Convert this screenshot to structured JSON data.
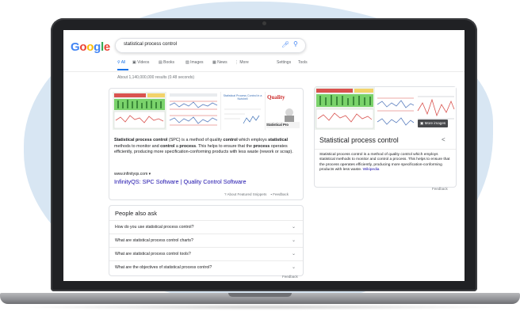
{
  "colors": {
    "blob": "#d8e6f3",
    "laptop_frame": "#202124",
    "google_blue": "#4285f4",
    "google_red": "#ea4335",
    "google_yellow": "#fbbc05",
    "google_green": "#34a853",
    "link": "#1a0dab",
    "active_tab": "#1a73e8",
    "quality_red": "#cc2a2a",
    "chart_green": "#7ad36b"
  },
  "google": {
    "logo": {
      "g": "G",
      "o1": "o",
      "o2": "o",
      "g2": "g",
      "l": "l",
      "e": "e"
    },
    "search": {
      "query": "statistical process control"
    },
    "tabs": [
      {
        "label": "All",
        "icon": "search-icon"
      },
      {
        "label": "Videos",
        "icon": "video-icon"
      },
      {
        "label": "Books",
        "icon": "book-icon"
      },
      {
        "label": "Images",
        "icon": "image-icon"
      },
      {
        "label": "News",
        "icon": "news-icon"
      },
      {
        "label": "More",
        "icon": "more-icon"
      }
    ],
    "settings": "Settings",
    "tools": "Tools",
    "results_count": "About 1,140,000,000 results (0.48 seconds)"
  },
  "featured": {
    "image_titles": {
      "spc_nutshell": "Statistical Process Control in a Nutshell",
      "quality": "Quality",
      "spc": "Statistical Pro"
    },
    "snippet": {
      "p1b": "Statistical process control",
      "p2": " (SPC) is a method of quality ",
      "p3b": "control",
      "p4": " which employs ",
      "p5b": "statistical",
      "p6": " methods to monitor and ",
      "p7b": "control",
      "p8": " a ",
      "p9b": "process",
      "p10": ". This helps to ensure that the ",
      "p11b": "process",
      "p12": " operates efficiently, producing more specification-conforming products with less waste (rework or scrap)."
    },
    "site": "www.infinityqs.com",
    "link": "InfinityQS: SPC Software | Quality Control Software",
    "about": "About Featured Snippets",
    "feedback": "Feedback"
  },
  "paa": {
    "title": "People also ask",
    "questions": [
      "How do you use statistical process control?",
      "What are statistical process control charts?",
      "What are statistical process control tools?",
      "What are the objectives of statistical process control?"
    ],
    "feedback": "Feedback"
  },
  "knowledge_panel": {
    "more_images": "More images",
    "title": "Statistical process control",
    "description": "Statistical process control is a method of quality control which employs statistical methods to monitor and control a process. This helps to ensure that the process operates efficiently, producing more specification-conforming products with less waste.",
    "wiki": "Wikipedia",
    "feedback": "Feedback"
  }
}
